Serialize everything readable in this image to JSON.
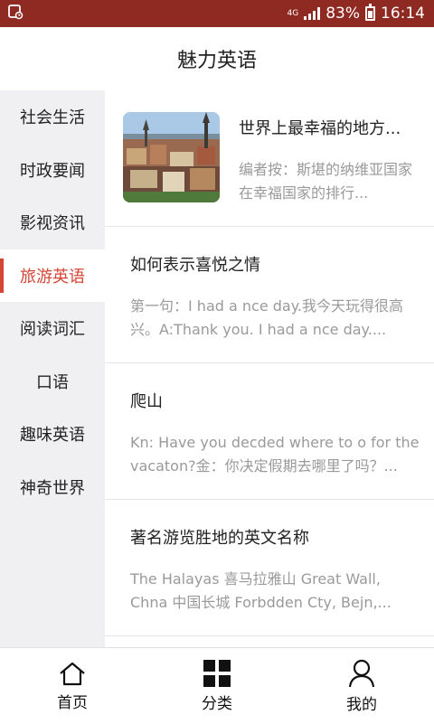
{
  "status": {
    "network": "4G",
    "battery": "83%",
    "time": "16:14"
  },
  "header": {
    "title": "魅力英语"
  },
  "sidebar": {
    "items": [
      {
        "label": "社会生活",
        "active": false
      },
      {
        "label": "时政要闻",
        "active": false
      },
      {
        "label": "影视资讯",
        "active": false
      },
      {
        "label": "旅游英语",
        "active": true
      },
      {
        "label": "阅读词汇",
        "active": false
      },
      {
        "label": "口语",
        "active": false
      },
      {
        "label": "趣味英语",
        "active": false
      },
      {
        "label": "神奇世界",
        "active": false
      }
    ]
  },
  "articles": [
    {
      "title": "世界上最幸福的地方...",
      "excerpt": "编者按：斯堪的纳维亚国家在幸福国家的排行...",
      "thumbnail": "city-photo"
    },
    {
      "title": "如何表示喜悦之情",
      "excerpt": "第一句：I had a nce day.我今天玩得很高兴。A:Thank you. I had a nce day...."
    },
    {
      "title": "爬山",
      "excerpt": "Kn: Have you decded where to o for the vacaton?金：你决定假期去哪里了吗？..."
    },
    {
      "title": "著名游览胜地的英文名称",
      "excerpt": "The Halayas 喜马拉雅山     Great Wall, Chna 中国长城     Forbdden Cty, Bejn,..."
    }
  ],
  "bottom_nav": {
    "home": "首页",
    "category": "分类",
    "mine": "我的"
  },
  "colors": {
    "statusbar": "#8e2a21",
    "accent": "#d44535"
  }
}
